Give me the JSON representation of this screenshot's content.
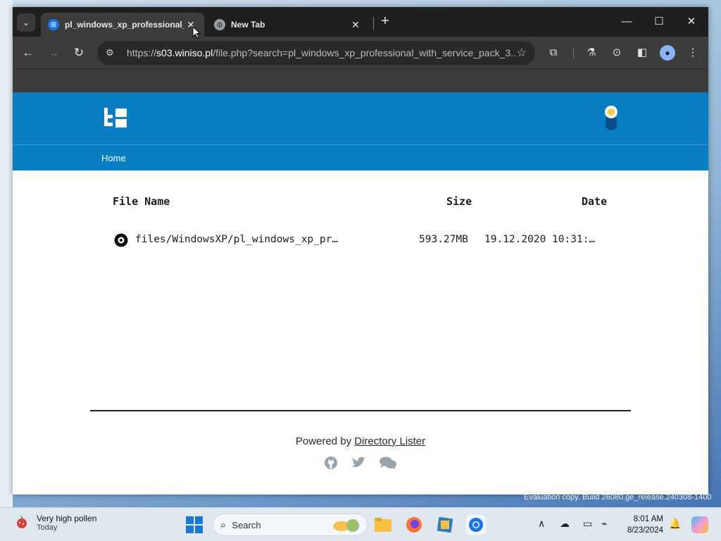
{
  "browser": {
    "tabs": [
      {
        "title": "pl_windows_xp_professional_w",
        "active": true
      },
      {
        "title": "New Tab",
        "active": false
      }
    ],
    "url_prefix": "https://",
    "url_host": "s03.winiso.pl",
    "url_rest": "/file.php?search=pl_windows_xp_professional_with_service_pack_3..."
  },
  "site": {
    "breadcrumb": "Home",
    "columns": {
      "name": "File Name",
      "size": "Size",
      "date": "Date"
    },
    "files": [
      {
        "name": "files/WindowsXP/pl_windows_xp_pr…",
        "size": "593.27MB",
        "date": "19.12.2020 10:31:…"
      }
    ],
    "footer": {
      "powered_prefix": "Powered by",
      "link": "Directory Lister"
    }
  },
  "desktop": {
    "watermark": "Evaluation copy. Build 26080.ge_release.240308-1400"
  },
  "taskbar": {
    "weather_title": "Very high pollen",
    "weather_sub": "Today",
    "search_label": "Search",
    "time": "8:01 AM",
    "date": "8/23/2024"
  },
  "colors": {
    "site_header": "#0a7ec3",
    "chrome_dark": "#1f1f1f"
  }
}
